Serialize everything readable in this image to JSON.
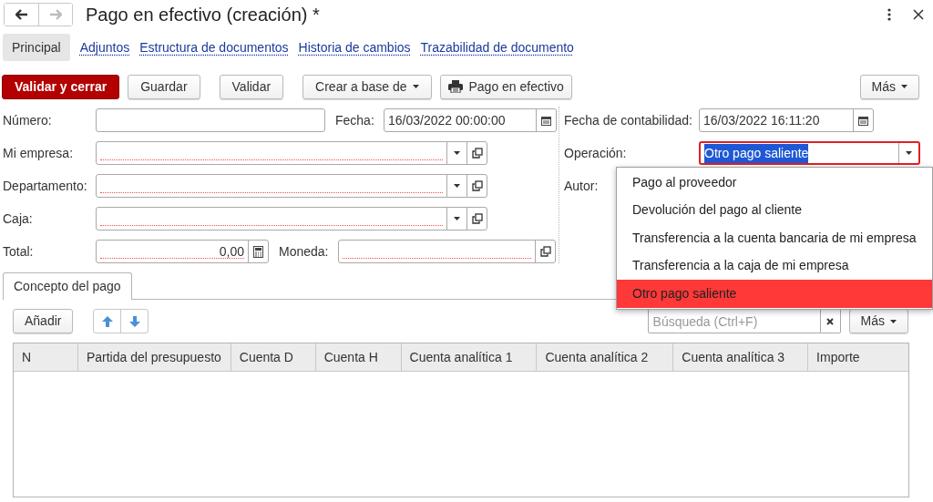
{
  "nav_buttons": [
    {
      "kind": "back",
      "disabled": false
    },
    {
      "kind": "forward",
      "disabled": true
    }
  ],
  "title": "Pago en efectivo (creación) *",
  "tabs": [
    {
      "label": "Principal",
      "selected": true
    },
    {
      "label": "Adjuntos",
      "selected": false
    },
    {
      "label": "Estructura de documentos",
      "selected": false
    },
    {
      "label": "Historia de cambios",
      "selected": false
    },
    {
      "label": "Trazabilidad de documento",
      "selected": false
    }
  ],
  "command_bar": {
    "buttons": [
      {
        "label": "Validar y cerrar",
        "kind": "primary"
      },
      {
        "label": "Guardar",
        "kind": "plain"
      },
      {
        "label": "Validar",
        "kind": "plain"
      },
      {
        "label": "Crear a base de",
        "kind": "dropdown"
      },
      {
        "label": "Pago en efectivo",
        "kind": "print"
      }
    ],
    "more": "Más"
  },
  "form": {
    "left_rows": [
      [
        {
          "label": "Número:",
          "kind": "text"
        },
        {
          "label": "Fecha:",
          "kind": "date",
          "value": "16/03/2022 00:00:00"
        }
      ],
      [
        {
          "label": "Mi empresa:",
          "kind": "select",
          "required": true
        }
      ],
      [
        {
          "label": "Departamento:",
          "kind": "select",
          "required": true
        }
      ],
      [
        {
          "label": "Caja:",
          "kind": "select",
          "required": true
        }
      ],
      [
        {
          "label": "Total:",
          "kind": "number",
          "value": "0,00",
          "required": true
        },
        {
          "label": "Moneda:",
          "kind": "link",
          "required": true
        }
      ]
    ],
    "right_rows": [
      {
        "label": "Fecha de contabilidad:",
        "kind": "date",
        "value": "16/03/2022 16:11:20"
      },
      {
        "label": "Operación:",
        "kind": "combo",
        "value": "Otro pago saliente",
        "focused": true
      },
      {
        "label": "Autor:",
        "kind": "label_only"
      }
    ]
  },
  "operation_options": [
    {
      "label": "Pago al proveedor",
      "selected": false
    },
    {
      "label": "Devolución del pago al cliente",
      "selected": false
    },
    {
      "label": "Transferencia a la cuenta bancaria de mi empresa",
      "selected": false
    },
    {
      "label": "Transferencia a la caja de mi empresa",
      "selected": false
    },
    {
      "label": "Otro pago saliente",
      "selected": true
    }
  ],
  "lines_section": {
    "tab": {
      "label": "Concepto del pago",
      "selected": true
    },
    "add_button": "Añadir",
    "search": {
      "placeholder": "Búsqueda (Ctrl+F)"
    },
    "more": "Más",
    "table": {
      "columns": [
        "N",
        "Partida del presupuesto",
        "Cuenta D",
        "Cuenta H",
        "Cuenta analítica 1",
        "Cuenta analítica 2",
        "Cuenta analítica 3",
        "Importe"
      ]
    }
  }
}
